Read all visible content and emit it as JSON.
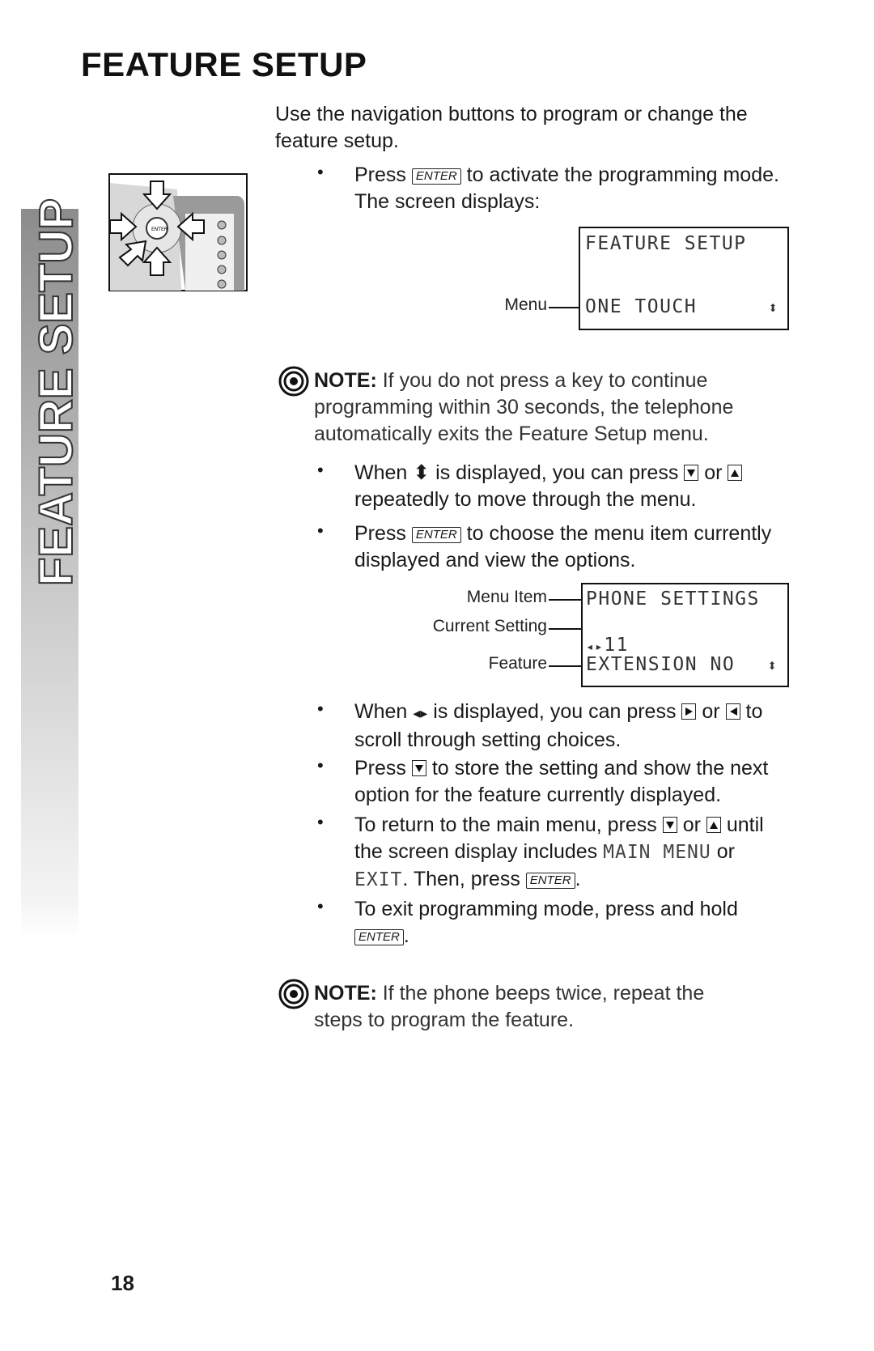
{
  "title": "FEATURE SETUP",
  "side_tab": "FEATURE SETUP",
  "intro": "Use the navigation buttons to program or change the feature setup.",
  "keys": {
    "enter": "ENTER"
  },
  "b1": {
    "pre": "Press",
    "post": "to activate the programming mode. The screen displays:"
  },
  "lcd1": {
    "line1": "FEATURE SETUP",
    "line2": "ONE TOUCH",
    "menu_label": "Menu"
  },
  "note1": {
    "label": "NOTE:",
    "text": "If you do not press a key to continue programming within 30 seconds, the telephone automatically exits the Feature Setup menu."
  },
  "b2": {
    "pre": "When",
    "mid": "is displayed, you can press",
    "or": "or",
    "post": "repeatedly to move through the menu."
  },
  "b3": {
    "pre": "Press",
    "post": "to choose the menu item currently displayed and view the options."
  },
  "lcd2": {
    "line1": "PHONE SETTINGS",
    "setting": "11",
    "line3": "EXTENSION NO",
    "labels": {
      "menu_item": "Menu Item",
      "current_setting": "Current Setting",
      "feature": "Feature"
    }
  },
  "b4": {
    "pre": "When",
    "mid": "is displayed, you can press",
    "or": "or",
    "post": "to scroll through setting choices."
  },
  "b5": {
    "pre": "Press",
    "post": "to store the setting and show the next option for the feature currently displayed."
  },
  "b6": {
    "pre": "To return to the main menu, press",
    "or": "or",
    "mid": "until the screen display includes",
    "main_menu": "MAIN MENU",
    "or2": "or",
    "exit": "EXIT",
    "then": ". Then, press",
    "end": "."
  },
  "b7": {
    "pre": "To exit programming mode, press and hold",
    "end": "."
  },
  "note2": {
    "label": "NOTE:",
    "text": "If the phone beeps twice, repeat the steps to program the feature."
  },
  "page_number": "18"
}
